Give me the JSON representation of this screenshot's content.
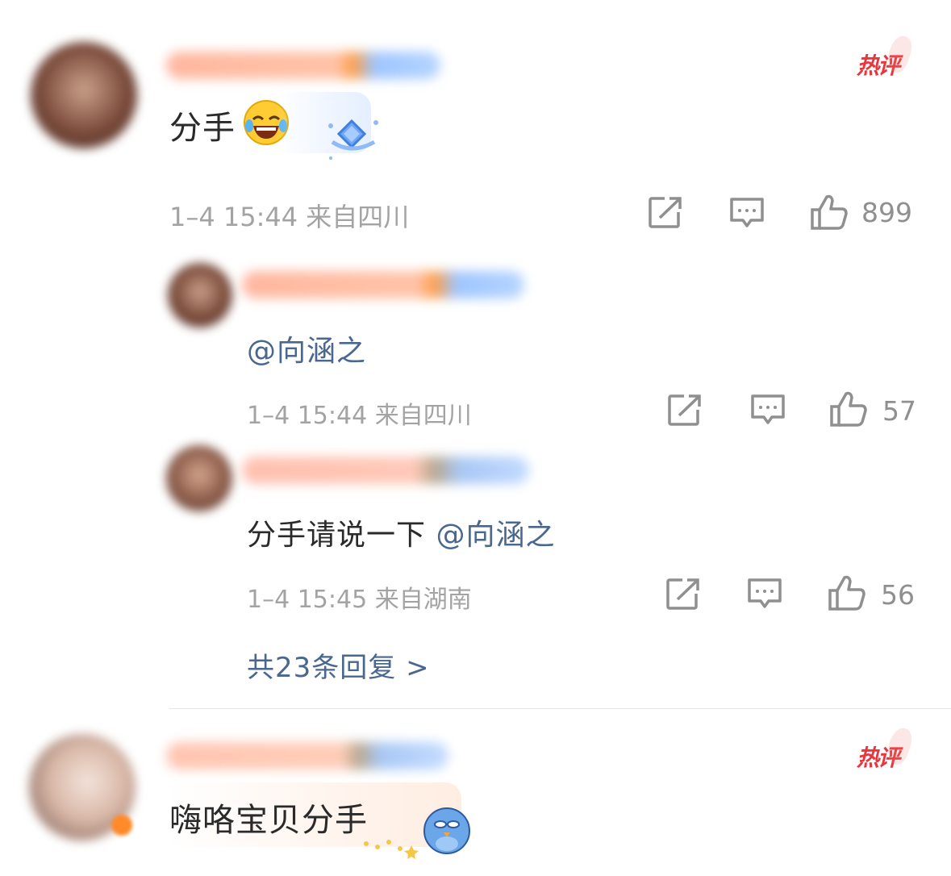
{
  "comments": [
    {
      "text": "分手",
      "meta": "1–4 15:44 来自四川",
      "likes": "899",
      "badge": "热评",
      "replies": [
        {
          "mention": "@向涵之",
          "meta": "1–4 15:44 来自四川",
          "likes": "57"
        },
        {
          "text": "分手请说一下",
          "mention": "@向涵之",
          "meta": "1–4 15:45 来自湖南",
          "likes": "56"
        }
      ],
      "more_replies": "共23条回复 >"
    },
    {
      "text": "嗨咯宝贝分手",
      "badge": "热评"
    }
  ],
  "colors": {
    "hot": "#e8363c",
    "link": "#4a6790",
    "meta": "#a3a3a3"
  },
  "icons": [
    "share-icon",
    "comment-icon",
    "like-icon",
    "laughing-emoji-icon",
    "diamond-sticker-icon",
    "bird-sticker-icon"
  ]
}
